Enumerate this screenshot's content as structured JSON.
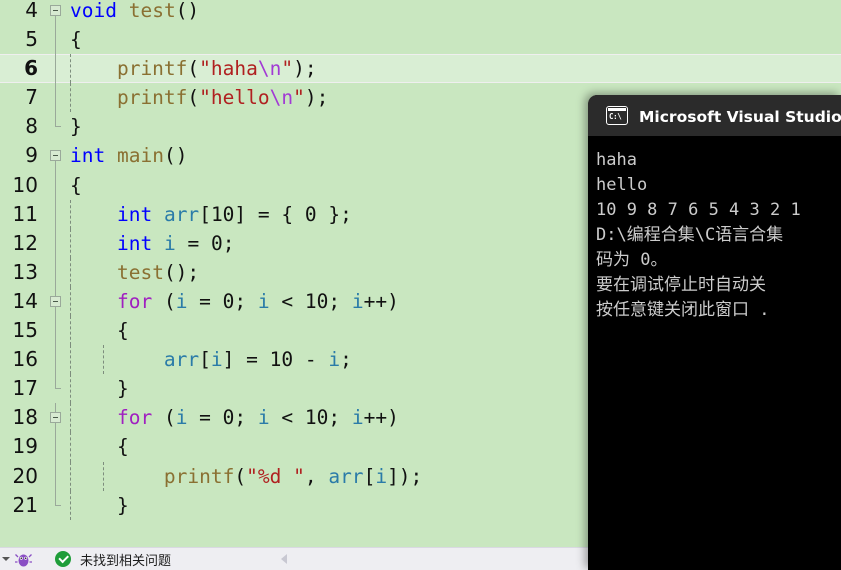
{
  "editor": {
    "background_color": "#c9e7c0",
    "current_line": 6,
    "lines": [
      {
        "num": "4",
        "indent_guides": 0,
        "fold": "open-start",
        "foldline": "none",
        "tokens": [
          {
            "t": "void",
            "c": "kw"
          },
          {
            "t": " ",
            "c": "pl"
          },
          {
            "t": "test",
            "c": "fn"
          },
          {
            "t": "()",
            "c": "pl"
          }
        ]
      },
      {
        "num": "5",
        "indent_guides": 0,
        "fold": "none",
        "foldline": "line",
        "tokens": [
          {
            "t": "{",
            "c": "pl"
          }
        ]
      },
      {
        "num": "6",
        "indent_guides": 1,
        "fold": "none",
        "foldline": "line",
        "tokens": [
          {
            "t": "    printf",
            "c": "fn"
          },
          {
            "t": "(",
            "c": "pl"
          },
          {
            "t": "\"haha",
            "c": "str"
          },
          {
            "t": "\\n",
            "c": "esc"
          },
          {
            "t": "\"",
            "c": "str"
          },
          {
            "t": ");",
            "c": "pl"
          }
        ]
      },
      {
        "num": "7",
        "indent_guides": 1,
        "fold": "none",
        "foldline": "line",
        "tokens": [
          {
            "t": "    printf",
            "c": "fn"
          },
          {
            "t": "(",
            "c": "pl"
          },
          {
            "t": "\"hello",
            "c": "str"
          },
          {
            "t": "\\n",
            "c": "esc"
          },
          {
            "t": "\"",
            "c": "str"
          },
          {
            "t": ");",
            "c": "pl"
          }
        ]
      },
      {
        "num": "8",
        "indent_guides": 0,
        "fold": "none",
        "foldline": "end",
        "tokens": [
          {
            "t": "}",
            "c": "pl"
          }
        ]
      },
      {
        "num": "9",
        "indent_guides": 0,
        "fold": "open-start",
        "foldline": "none",
        "tokens": [
          {
            "t": "int",
            "c": "kw"
          },
          {
            "t": " ",
            "c": "pl"
          },
          {
            "t": "main",
            "c": "fn"
          },
          {
            "t": "()",
            "c": "pl"
          }
        ]
      },
      {
        "num": "10",
        "indent_guides": 0,
        "fold": "none",
        "foldline": "line",
        "tokens": [
          {
            "t": "{",
            "c": "pl"
          }
        ]
      },
      {
        "num": "11",
        "indent_guides": 1,
        "fold": "none",
        "foldline": "line",
        "tokens": [
          {
            "t": "    ",
            "c": "pl"
          },
          {
            "t": "int",
            "c": "kw"
          },
          {
            "t": " ",
            "c": "pl"
          },
          {
            "t": "arr",
            "c": "var"
          },
          {
            "t": "[",
            "c": "pl"
          },
          {
            "t": "10",
            "c": "num"
          },
          {
            "t": "] = { ",
            "c": "pl"
          },
          {
            "t": "0",
            "c": "num"
          },
          {
            "t": " };",
            "c": "pl"
          }
        ]
      },
      {
        "num": "12",
        "indent_guides": 1,
        "fold": "none",
        "foldline": "line",
        "tokens": [
          {
            "t": "    ",
            "c": "pl"
          },
          {
            "t": "int",
            "c": "kw"
          },
          {
            "t": " ",
            "c": "pl"
          },
          {
            "t": "i",
            "c": "var"
          },
          {
            "t": " = ",
            "c": "pl"
          },
          {
            "t": "0",
            "c": "num"
          },
          {
            "t": ";",
            "c": "pl"
          }
        ]
      },
      {
        "num": "13",
        "indent_guides": 1,
        "fold": "none",
        "foldline": "line",
        "tokens": [
          {
            "t": "    ",
            "c": "pl"
          },
          {
            "t": "test",
            "c": "fn"
          },
          {
            "t": "();",
            "c": "pl"
          }
        ]
      },
      {
        "num": "14",
        "indent_guides": 1,
        "fold": "open-start",
        "foldline": "line",
        "tokens": [
          {
            "t": "    ",
            "c": "pl"
          },
          {
            "t": "for",
            "c": "kwctl"
          },
          {
            "t": " (",
            "c": "pl"
          },
          {
            "t": "i",
            "c": "var"
          },
          {
            "t": " = ",
            "c": "pl"
          },
          {
            "t": "0",
            "c": "num"
          },
          {
            "t": "; ",
            "c": "pl"
          },
          {
            "t": "i",
            "c": "var"
          },
          {
            "t": " < ",
            "c": "pl"
          },
          {
            "t": "10",
            "c": "num"
          },
          {
            "t": "; ",
            "c": "pl"
          },
          {
            "t": "i",
            "c": "var"
          },
          {
            "t": "++)",
            "c": "pl"
          }
        ]
      },
      {
        "num": "15",
        "indent_guides": 1,
        "fold": "none",
        "foldline": "line",
        "tokens": [
          {
            "t": "    {",
            "c": "pl"
          }
        ]
      },
      {
        "num": "16",
        "indent_guides": 2,
        "fold": "none",
        "foldline": "line",
        "tokens": [
          {
            "t": "        ",
            "c": "pl"
          },
          {
            "t": "arr",
            "c": "var"
          },
          {
            "t": "[",
            "c": "pl"
          },
          {
            "t": "i",
            "c": "var"
          },
          {
            "t": "] = ",
            "c": "pl"
          },
          {
            "t": "10",
            "c": "num"
          },
          {
            "t": " - ",
            "c": "pl"
          },
          {
            "t": "i",
            "c": "var"
          },
          {
            "t": ";",
            "c": "pl"
          }
        ]
      },
      {
        "num": "17",
        "indent_guides": 1,
        "fold": "none",
        "foldline": "endcap",
        "tokens": [
          {
            "t": "    }",
            "c": "pl"
          }
        ]
      },
      {
        "num": "18",
        "indent_guides": 1,
        "fold": "open-start",
        "foldline": "line",
        "tokens": [
          {
            "t": "    ",
            "c": "pl"
          },
          {
            "t": "for",
            "c": "kwctl"
          },
          {
            "t": " (",
            "c": "pl"
          },
          {
            "t": "i",
            "c": "var"
          },
          {
            "t": " = ",
            "c": "pl"
          },
          {
            "t": "0",
            "c": "num"
          },
          {
            "t": "; ",
            "c": "pl"
          },
          {
            "t": "i",
            "c": "var"
          },
          {
            "t": " < ",
            "c": "pl"
          },
          {
            "t": "10",
            "c": "num"
          },
          {
            "t": "; ",
            "c": "pl"
          },
          {
            "t": "i",
            "c": "var"
          },
          {
            "t": "++)",
            "c": "pl"
          }
        ]
      },
      {
        "num": "19",
        "indent_guides": 1,
        "fold": "none",
        "foldline": "line",
        "tokens": [
          {
            "t": "    {",
            "c": "pl"
          }
        ]
      },
      {
        "num": "20",
        "indent_guides": 2,
        "fold": "none",
        "foldline": "line",
        "tokens": [
          {
            "t": "        printf",
            "c": "fn"
          },
          {
            "t": "(",
            "c": "pl"
          },
          {
            "t": "\"",
            "c": "str"
          },
          {
            "t": "%d",
            "c": "str"
          },
          {
            "t": " \"",
            "c": "str"
          },
          {
            "t": ", ",
            "c": "pl"
          },
          {
            "t": "arr",
            "c": "var"
          },
          {
            "t": "[",
            "c": "pl"
          },
          {
            "t": "i",
            "c": "var"
          },
          {
            "t": "]);",
            "c": "pl"
          }
        ]
      },
      {
        "num": "21",
        "indent_guides": 1,
        "fold": "none",
        "foldline": "endcap",
        "tokens": [
          {
            "t": "    }",
            "c": "pl"
          }
        ]
      }
    ]
  },
  "statusbar": {
    "caret_icon": "chevron-down-icon",
    "bug_icon": "debug-bug-icon",
    "status_icon": "success-check-icon",
    "status_text": "未找到相关问题",
    "nav_arrow_icon": "left-triangle-icon"
  },
  "console": {
    "icon_name": "cmd-console-icon",
    "icon_glyph": "C:\\",
    "title": "Microsoft Visual Studio 调试",
    "titlebar_color": "#2b2b2b",
    "background_color": "#000000",
    "text_color": "#cccccc",
    "output_lines": [
      "haha",
      "hello",
      "10 9 8 7 6 5 4 3 2 1",
      "D:\\编程合集\\C语言合集",
      "码为 0。",
      "要在调试停止时自动关",
      "按任意键关闭此窗口 ."
    ]
  }
}
